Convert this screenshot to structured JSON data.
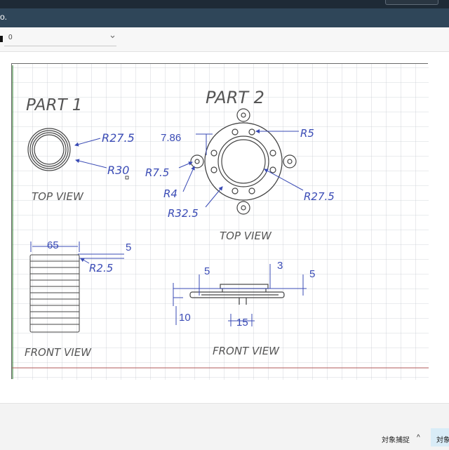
{
  "app": {
    "title": "o."
  },
  "toolbar": {
    "layer_value": "0"
  },
  "drawing": {
    "part1": {
      "title": "PART 1",
      "top_view_label": "TOP VIEW",
      "front_view_label": "FRONT VIEW",
      "dims": {
        "r_inner": "R27.5",
        "r_outer": "R30",
        "width": "65",
        "pitch": "5",
        "fillet": "R2.5"
      }
    },
    "part2": {
      "title": "PART 2",
      "top_view_label": "TOP VIEW",
      "front_view_label": "FRONT VIEW",
      "dims": {
        "offset": "7.86",
        "r_hole": "R5",
        "r_tab": "R7.5",
        "r_small": "R4",
        "r_ring": "R27.5",
        "r_outer": "R32.5",
        "thick_left": "5",
        "thick_top": "3",
        "thick_right": "5",
        "base": "10",
        "hub": "15"
      }
    }
  },
  "statusbar": {
    "snap_label": "対象捕捉",
    "snap_toggle": "^",
    "snap_active": "対象"
  }
}
